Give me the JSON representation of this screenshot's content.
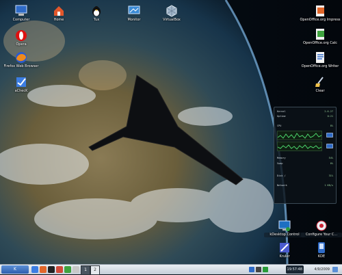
{
  "colors": {
    "accent": "#2d5fae",
    "graph": "#4bd36b",
    "taskbar": "#d8dfe6"
  },
  "desktop_icons_left": [
    {
      "label": "Computer",
      "icon": "computer-icon"
    },
    {
      "label": "Opera",
      "icon": "opera-icon"
    },
    {
      "label": "Firefox Web Browser",
      "icon": "firefox-icon"
    },
    {
      "label": "aChecK",
      "icon": "check-tool-icon"
    }
  ],
  "desktop_icons_top": [
    {
      "label": "Home",
      "icon": "home-folder-icon"
    },
    {
      "label": "Tux",
      "icon": "tux-icon"
    },
    {
      "label": "Monitor",
      "icon": "display-icon"
    },
    {
      "label": "VirtualBox",
      "icon": "virtualbox-icon"
    }
  ],
  "desktop_icons_right": [
    {
      "label": "OpenOffice.org Impress",
      "icon": "impress-icon"
    },
    {
      "label": "OpenOffice.org Calc",
      "icon": "calc-icon"
    },
    {
      "label": "OpenOffice.org Writer",
      "icon": "writer-icon"
    },
    {
      "label": "Clear",
      "icon": "broom-icon"
    }
  ],
  "desktop_icons_bottom_right": [
    {
      "label": "Configure Your C...",
      "icon": "configure-icon"
    },
    {
      "label": "KDE",
      "icon": "kde-icon"
    }
  ],
  "desktop_icons_bottom_mid": [
    {
      "label": "kDesktop Control",
      "icon": "desktop-control-icon"
    },
    {
      "label": "Kruler",
      "icon": "ruler-icon"
    }
  ],
  "sysmon": {
    "rows": [
      {
        "label": "Kernel",
        "value": "2.6.27"
      },
      {
        "label": "Uptime",
        "value": "0:21"
      },
      {
        "label": "CPU",
        "value": "8%"
      },
      {
        "label": "Memory",
        "value": "54%"
      },
      {
        "label": "Swap",
        "value": "0%"
      },
      {
        "label": "Disk /",
        "value": "31%"
      },
      {
        "label": "Network",
        "value": "1 KB/s"
      }
    ]
  },
  "taskbar": {
    "menu_label": "K",
    "pager": [
      "1",
      "2"
    ],
    "clock": "19:57:48",
    "date": "4/9/2009"
  }
}
